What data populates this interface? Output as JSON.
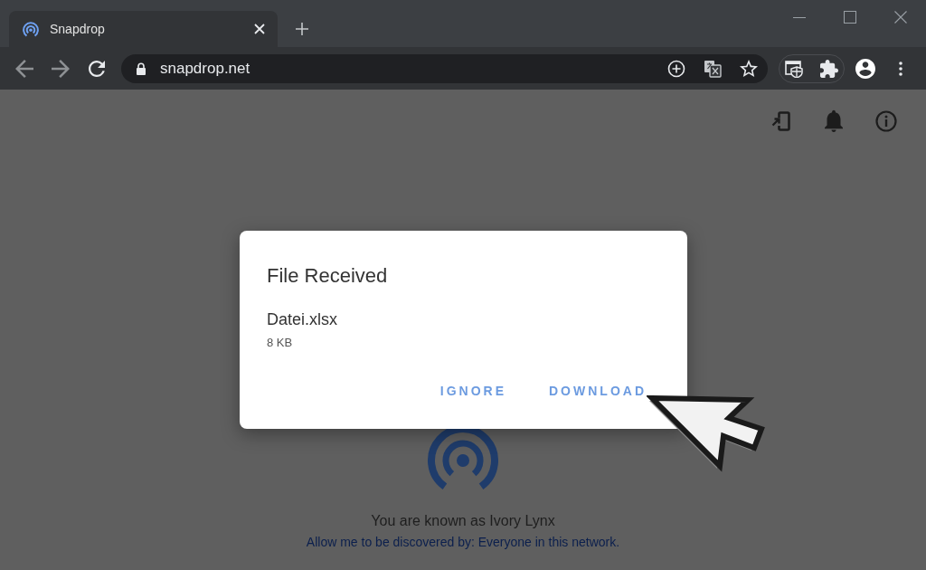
{
  "browser": {
    "tabs": [
      {
        "title": "Snapdrop",
        "selected": true
      }
    ],
    "address_bar": {
      "url": "snapdrop.net"
    }
  },
  "dialog": {
    "title": "File Received",
    "file_name": "Datei.xlsx",
    "file_size": "8 KB",
    "buttons": [
      "IGNORE",
      "DOWNLOAD"
    ]
  },
  "page": {
    "device_name": "You are known as Ivory Lynx",
    "discovery_link": "Allow me to be discovered by: Everyone in this network."
  }
}
